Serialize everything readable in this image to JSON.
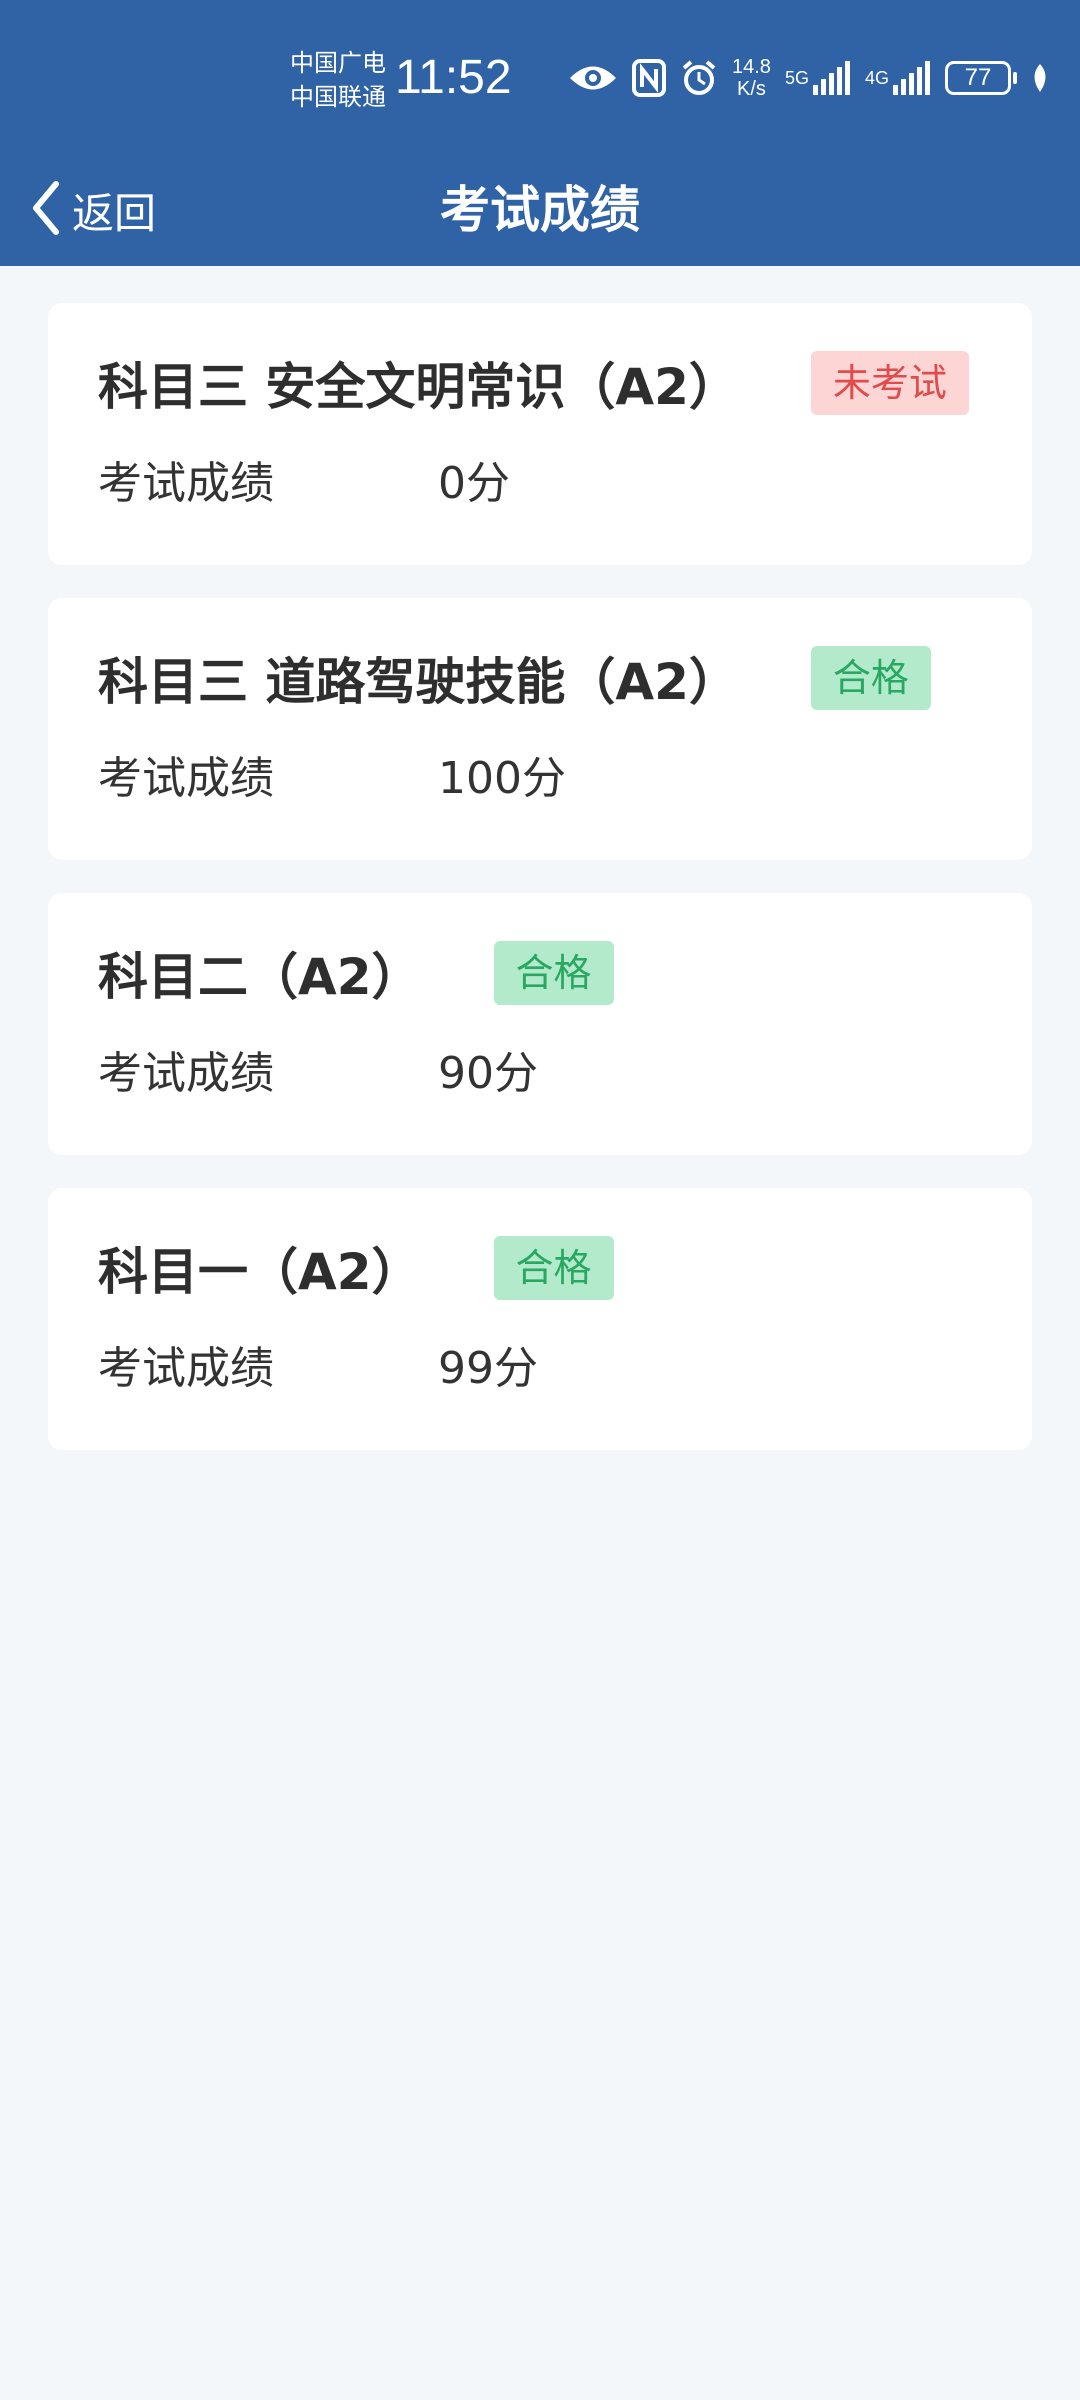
{
  "status_bar": {
    "carrier_1": "中国广电",
    "carrier_2": "中国联通",
    "time": "11:52",
    "net_speed_value": "14.8",
    "net_speed_unit": "K/s",
    "signal_5g_label": "5G",
    "signal_4g_label": "4G",
    "battery": "77",
    "icons": [
      "eye-icon",
      "nfc-icon",
      "alarm-icon",
      "signal-5g-icon",
      "signal-4g-icon",
      "battery-icon",
      "leaf-icon"
    ]
  },
  "nav": {
    "back_label": "返回",
    "title": "考试成绩"
  },
  "results": [
    {
      "subject": "科目三 安全文明常识（A2）",
      "status": "未考试",
      "status_type": "fail",
      "score_label": "考试成绩",
      "score": "0分"
    },
    {
      "subject": "科目三 道路驾驶技能（A2）",
      "status": "合格",
      "status_type": "pass",
      "score_label": "考试成绩",
      "score": "100分"
    },
    {
      "subject": "科目二（A2）",
      "status": "合格",
      "status_type": "pass",
      "score_label": "考试成绩",
      "score": "90分"
    },
    {
      "subject": "科目一（A2）",
      "status": "合格",
      "status_type": "pass",
      "score_label": "考试成绩",
      "score": "99分"
    }
  ],
  "colors": {
    "header_bg": "#2f63a6",
    "page_bg": "#f3f7fa",
    "fail_bg": "#fdd5d5",
    "fail_text": "#e04b4b",
    "pass_bg": "#b3eacb",
    "pass_text": "#28a862"
  }
}
